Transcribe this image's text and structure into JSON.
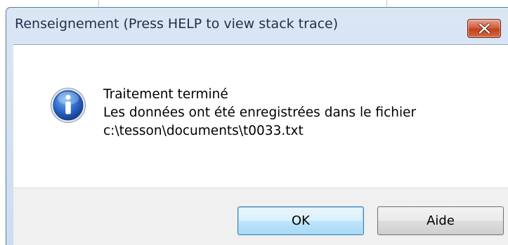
{
  "dialog": {
    "title": "Renseignement (Press HELP to view stack trace)",
    "close_icon": "close-icon",
    "icon": "information-icon",
    "message_lines": [
      "Traitement terminé",
      "Les données ont été enregistrées dans le fichier",
      "c:\\tesson\\documents\\t0033.txt"
    ],
    "buttons": {
      "ok": "OK",
      "help": "Aide"
    }
  },
  "colors": {
    "titlebar": "#cdddf0",
    "close_button": "#c2421c",
    "footer": "#f0f0f0",
    "default_button_border": "#3c7fb1"
  }
}
